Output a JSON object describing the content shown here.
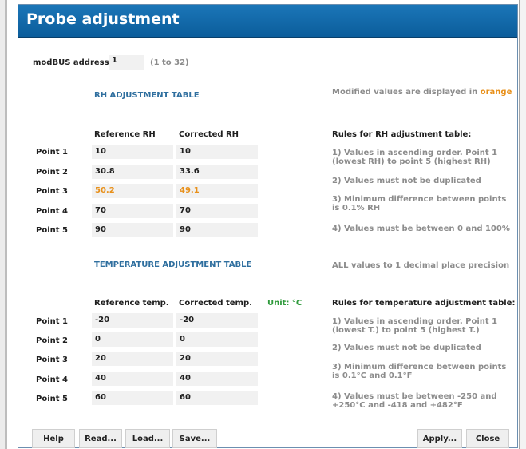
{
  "title": "Probe adjustment",
  "modbus": {
    "label": "modBUS address",
    "value": "1",
    "range": "(1 to 32)"
  },
  "note": {
    "prefix": "Modified values are displayed in ",
    "highlight": "orange"
  },
  "rh": {
    "heading": "RH ADJUSTMENT TABLE",
    "col_ref": "Reference RH",
    "col_corr": "Corrected RH",
    "rows": [
      {
        "label": "Point 1",
        "ref": "10",
        "corr": "10",
        "modified": false
      },
      {
        "label": "Point 2",
        "ref": "30.8",
        "corr": "33.6",
        "modified": false
      },
      {
        "label": "Point 3",
        "ref": "50.2",
        "corr": "49.1",
        "modified": true
      },
      {
        "label": "Point 4",
        "ref": "70",
        "corr": "70",
        "modified": false
      },
      {
        "label": "Point 5",
        "ref": "90",
        "corr": "90",
        "modified": false
      }
    ],
    "rules_title": "Rules for RH adjustment table:",
    "rules": [
      "1) Values in ascending order. Point 1 (lowest RH) to point 5 (highest RH)",
      "2) Values must not be duplicated",
      "3) Minimum difference between points is 0.1% RH",
      "4) Values must be between 0 and 100%"
    ]
  },
  "precision_note": "ALL values to 1 decimal place precision",
  "temp": {
    "heading": "TEMPERATURE ADJUSTMENT TABLE",
    "col_ref": "Reference temp.",
    "col_corr": "Corrected temp.",
    "unit": "Unit: °C",
    "rows": [
      {
        "label": "Point 1",
        "ref": "-20",
        "corr": "-20",
        "modified": false
      },
      {
        "label": "Point 2",
        "ref": "0",
        "corr": "0",
        "modified": false
      },
      {
        "label": "Point 3",
        "ref": "20",
        "corr": "20",
        "modified": false
      },
      {
        "label": "Point 4",
        "ref": "40",
        "corr": "40",
        "modified": false
      },
      {
        "label": "Point 5",
        "ref": "60",
        "corr": "60",
        "modified": false
      }
    ],
    "rules_title": "Rules for temperature adjustment table:",
    "rules": [
      "1) Values in ascending order. Point 1 (lowest T.) to point 5 (highest T.)",
      "2) Values must not be duplicated",
      "3) Minimum difference between points is 0.1°C and 0.1°F",
      "4) Values must be between -250 and +250°C and -418 and +482°F"
    ]
  },
  "buttons": {
    "help": "Help",
    "read": "Read...",
    "load": "Load...",
    "save": "Save...",
    "apply": "Apply...",
    "close": "Close"
  },
  "colors": {
    "title_bar": "#0b5d9b",
    "section_heading": "#2f6f9f",
    "modified": "#e8901a",
    "unit": "#2f9a3c"
  }
}
